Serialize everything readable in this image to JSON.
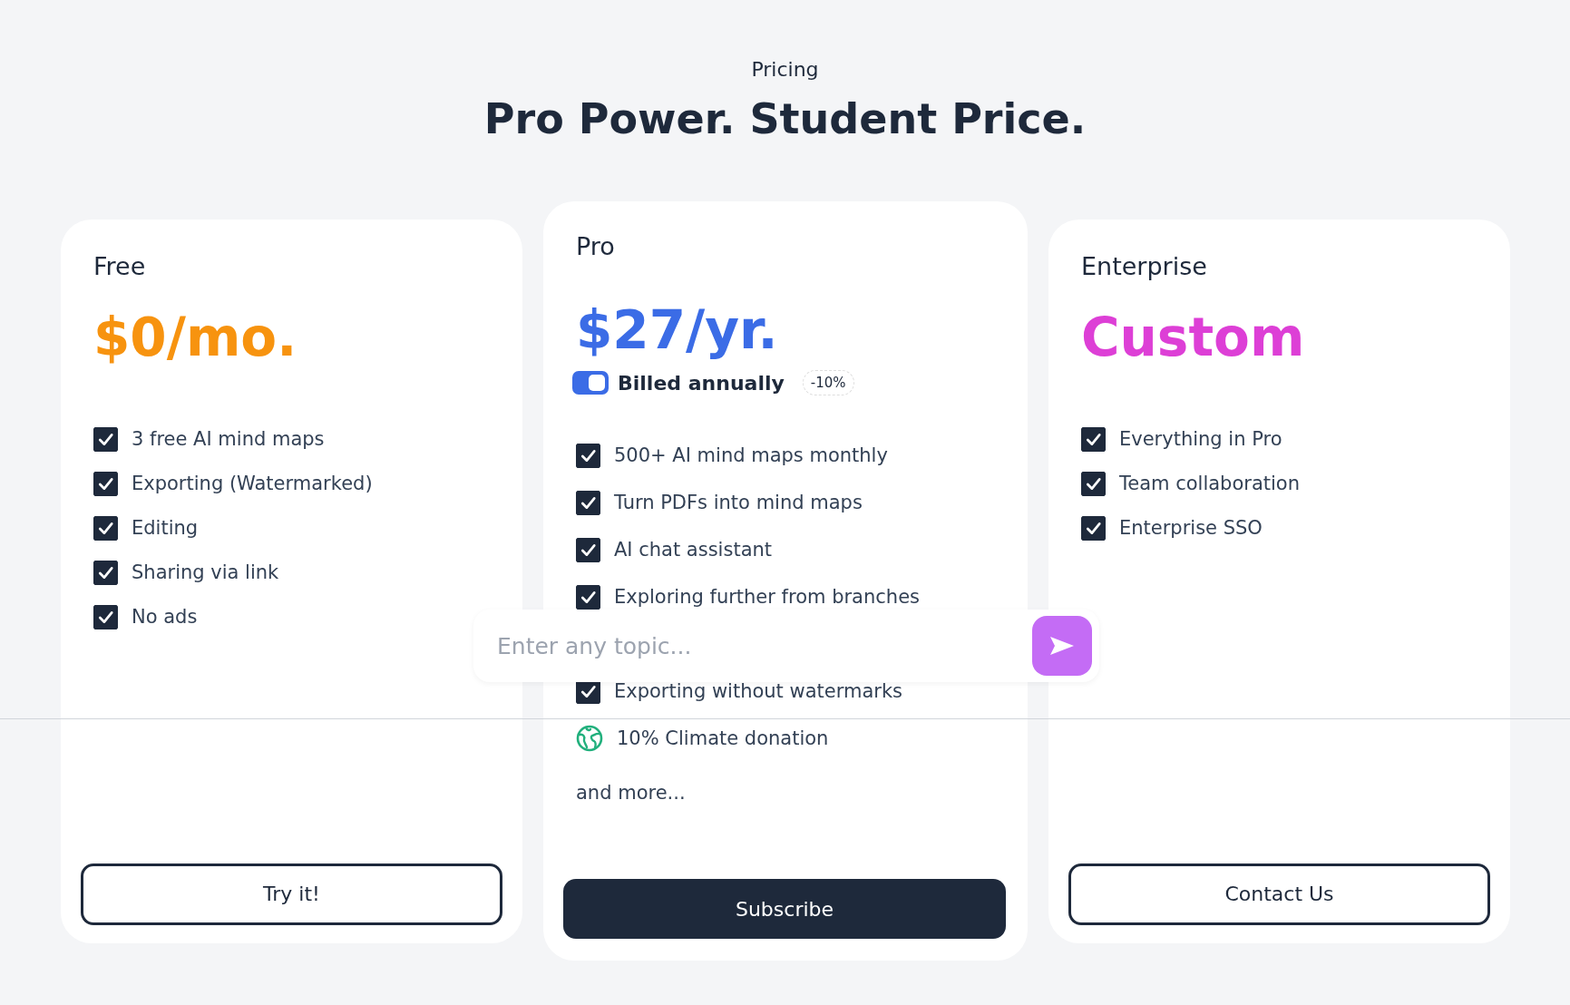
{
  "header": {
    "eyebrow": "Pricing",
    "title": "Pro Power. Student Price."
  },
  "plans": [
    {
      "name": "Free",
      "price": "$0/mo.",
      "color": "#f7930f",
      "featured": false,
      "features": [
        {
          "kind": "check",
          "checked": true,
          "text": "3 free AI mind maps"
        },
        {
          "kind": "check",
          "checked": true,
          "text": "Exporting (Watermarked)"
        },
        {
          "kind": "check",
          "checked": true,
          "text": "Editing"
        },
        {
          "kind": "check",
          "checked": true,
          "text": "Sharing via link"
        },
        {
          "kind": "check",
          "checked": true,
          "text": "No ads"
        }
      ],
      "button": {
        "label": "Try it!",
        "kind": "outline"
      }
    },
    {
      "name": "Pro",
      "price": "$27/yr.",
      "color": "#3b6ce6",
      "featured": true,
      "billing": {
        "label": "Billed annually",
        "on": true,
        "badge": "-10%"
      },
      "features": [
        {
          "kind": "check",
          "checked": true,
          "text": "500+ AI mind maps monthly"
        },
        {
          "kind": "check",
          "checked": true,
          "text": "Turn PDFs into mind maps"
        },
        {
          "kind": "check",
          "checked": true,
          "text": "AI chat assistant"
        },
        {
          "kind": "check",
          "checked": true,
          "text": "Exploring further from branches"
        },
        {
          "kind": "hidden"
        },
        {
          "kind": "check",
          "checked": true,
          "text": "Exporting without watermarks"
        },
        {
          "kind": "globe",
          "text": "10% Climate donation"
        }
      ],
      "more": "and more...",
      "button": {
        "label": "Subscribe",
        "kind": "solid"
      }
    },
    {
      "name": "Enterprise",
      "price": "Custom",
      "color": "#dd3fd6",
      "featured": false,
      "features": [
        {
          "kind": "check",
          "checked": true,
          "text": "Everything in Pro"
        },
        {
          "kind": "check",
          "checked": true,
          "text": "Team collaboration"
        },
        {
          "kind": "check",
          "checked": true,
          "text": "Enterprise SSO"
        }
      ],
      "button": {
        "label": "Contact Us",
        "kind": "outline"
      }
    }
  ],
  "topic_input": {
    "placeholder": "Enter any topic..."
  }
}
